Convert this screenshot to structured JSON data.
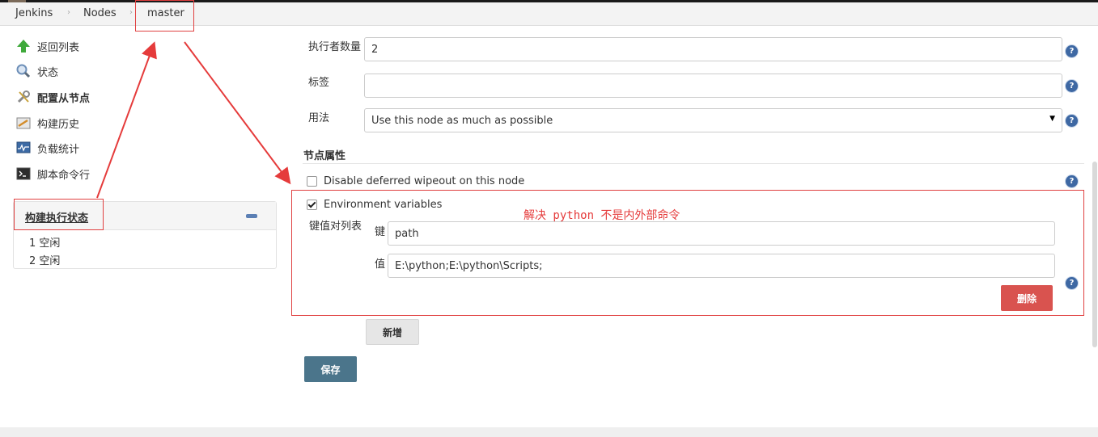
{
  "breadcrumb": {
    "items": [
      "Jenkins",
      "Nodes",
      "master"
    ],
    "separator": "›"
  },
  "sidebar": {
    "items": [
      {
        "label": "返回列表",
        "icon": "up-arrow-icon"
      },
      {
        "label": "状态",
        "icon": "search-icon"
      },
      {
        "label": "配置从节点",
        "icon": "wrench-icon"
      },
      {
        "label": "构建历史",
        "icon": "notepad-icon"
      },
      {
        "label": "负载统计",
        "icon": "monitor-graph-icon"
      },
      {
        "label": "脚本命令行",
        "icon": "terminal-icon"
      }
    ]
  },
  "executor_panel": {
    "title": "构建执行状态",
    "executors": [
      "1 空闲",
      "2 空闲"
    ]
  },
  "form": {
    "executors_label": "执行者数量",
    "executors_value": "2",
    "labels_label": "标签",
    "labels_value": "",
    "usage_label": "用法",
    "usage_value": "Use this node as much as possible",
    "node_properties_title": "节点属性",
    "disable_wipeout_label": "Disable deferred wipeout on this node",
    "disable_wipeout_checked": false,
    "env_vars_label": "Environment variables",
    "env_vars_checked": true,
    "kv_list_label": "键值对列表",
    "key_label": "键",
    "key_value": "path",
    "value_label": "值",
    "value_value": "E:\\python;E:\\python\\Scripts;",
    "delete_button": "删除",
    "add_button": "新增",
    "save_button": "保存",
    "help_glyph": "?"
  },
  "annotation": {
    "note": "解决 python 不是内外部命令",
    "color": "#e53b3b"
  },
  "colors": {
    "help_icon": "#3e68a3",
    "delete_button": "#d9534f",
    "save_button": "#4b758b"
  }
}
